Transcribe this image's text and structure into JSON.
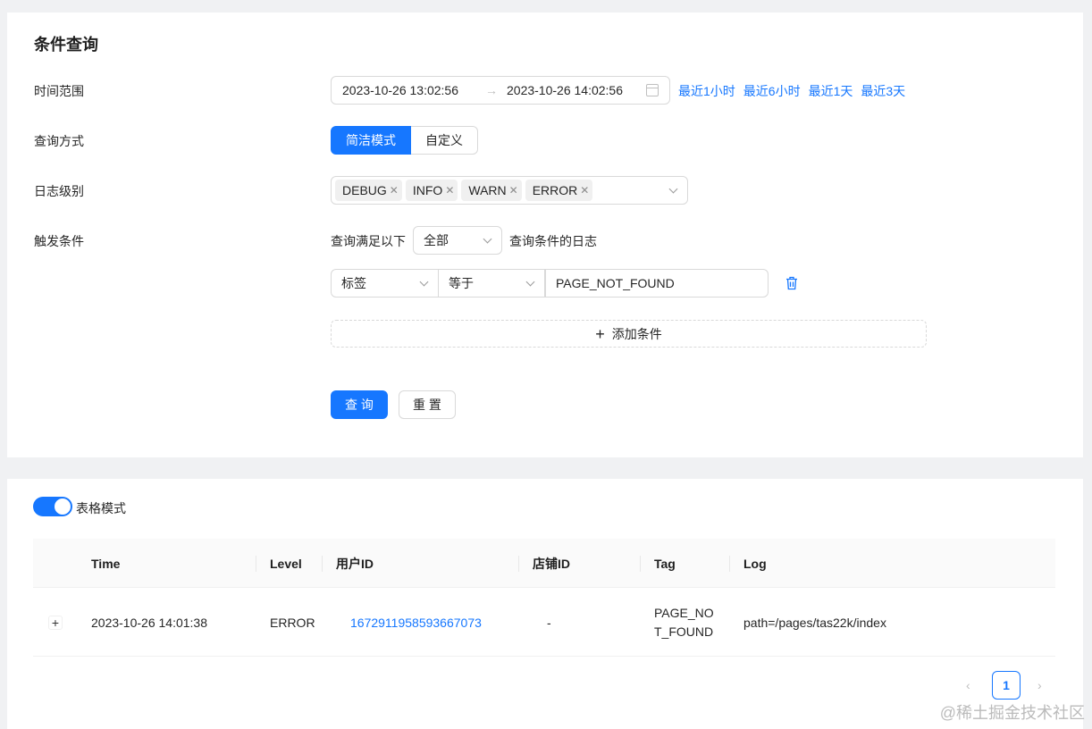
{
  "query": {
    "title": "条件查询",
    "time_range": {
      "label": "时间范围",
      "start": "2023-10-26 13:02:56",
      "arrow": "→",
      "end": "2023-10-26 14:02:56",
      "quick": [
        "最近1小时",
        "最近6小时",
        "最近1天",
        "最近3天"
      ]
    },
    "mode": {
      "label": "查询方式",
      "options": [
        "简洁模式",
        "自定义"
      ],
      "selected": "简洁模式"
    },
    "level": {
      "label": "日志级别",
      "tags": [
        "DEBUG",
        "INFO",
        "WARN",
        "ERROR"
      ]
    },
    "trigger": {
      "label": "触发条件",
      "prefix": "查询满足以下",
      "match": "全部",
      "suffix": "查询条件的日志",
      "condition": {
        "field": "标签",
        "op": "等于",
        "value": "PAGE_NOT_FOUND"
      },
      "add_label": "添加条件"
    },
    "submit_label": "查 询",
    "reset_label": "重 置"
  },
  "result": {
    "switch_label": "表格模式",
    "switch_on": true,
    "columns": [
      "Time",
      "Level",
      "用户ID",
      "店铺ID",
      "Tag",
      "Log"
    ],
    "rows": [
      {
        "expand": "+",
        "time": "2023-10-26 14:01:38",
        "level": "ERROR",
        "user_id": "1672911958593667073",
        "shop_id": "-",
        "tag_line1": "PAGE_NO",
        "tag_line2": "T_FOUND",
        "log": "path=/pages/tas22k/index"
      }
    ],
    "pagination": {
      "prev": "‹",
      "current": "1",
      "next": "›"
    }
  },
  "watermark": "@稀土掘金技术社区",
  "colors": {
    "primary": "#1677ff",
    "border": "#d9d9d9",
    "background": "#f0f1f3"
  }
}
